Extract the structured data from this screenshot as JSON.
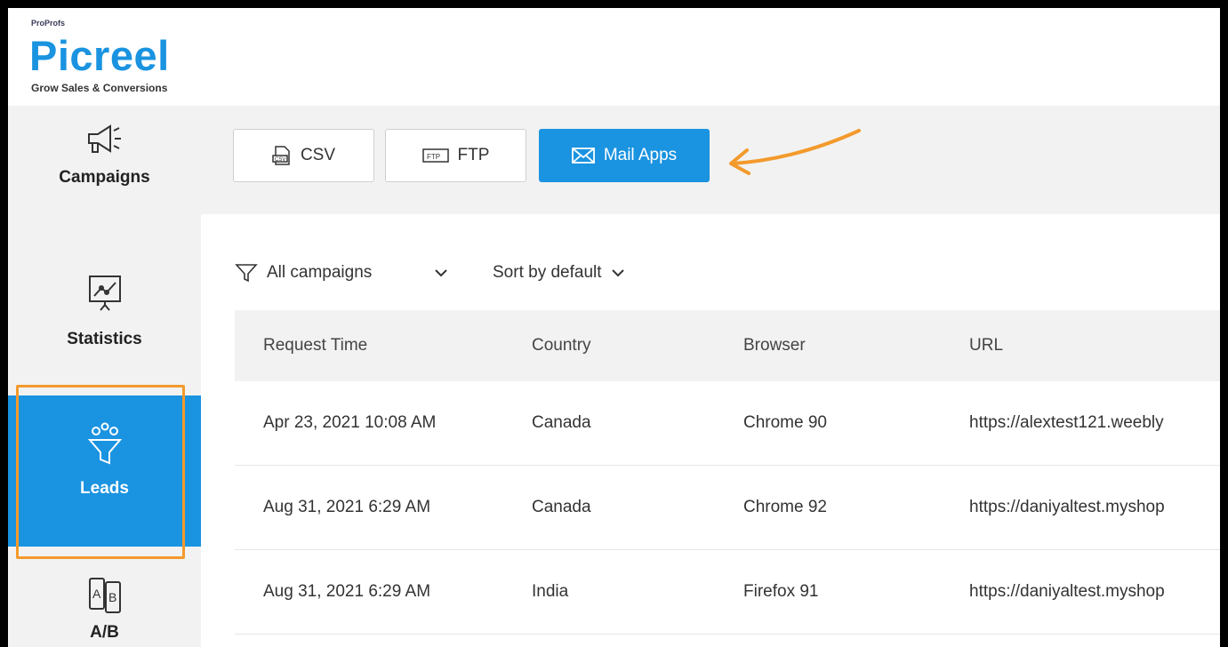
{
  "brand": {
    "top": "ProProfs",
    "name": "Picreel",
    "tagline": "Grow Sales & Conversions"
  },
  "sidebar": {
    "items": [
      {
        "label": "Campaigns",
        "icon": "megaphone-icon"
      },
      {
        "label": "Statistics",
        "icon": "chart-presentation-icon"
      },
      {
        "label": "Leads",
        "icon": "funnel-icon",
        "active": true
      },
      {
        "label": "A/B",
        "icon": "ab-test-icon"
      }
    ]
  },
  "export": {
    "csv": "CSV",
    "ftp": "FTP",
    "mail_apps": "Mail Apps"
  },
  "filters": {
    "campaigns": "All campaigns",
    "sort": "Sort by default"
  },
  "table": {
    "headers": [
      "Request Time",
      "Country",
      "Browser",
      "URL"
    ],
    "rows": [
      [
        "Apr 23, 2021 10:08 AM",
        "Canada",
        "Chrome 90",
        "https://alextest121.weebly"
      ],
      [
        "Aug 31, 2021 6:29 AM",
        "Canada",
        "Chrome 92",
        "https://daniyaltest.myshop"
      ],
      [
        "Aug 31, 2021 6:29 AM",
        "India",
        "Firefox 91",
        "https://daniyaltest.myshop"
      ]
    ]
  },
  "colors": {
    "accent": "#1a93e0",
    "highlight": "#f39a2c"
  }
}
